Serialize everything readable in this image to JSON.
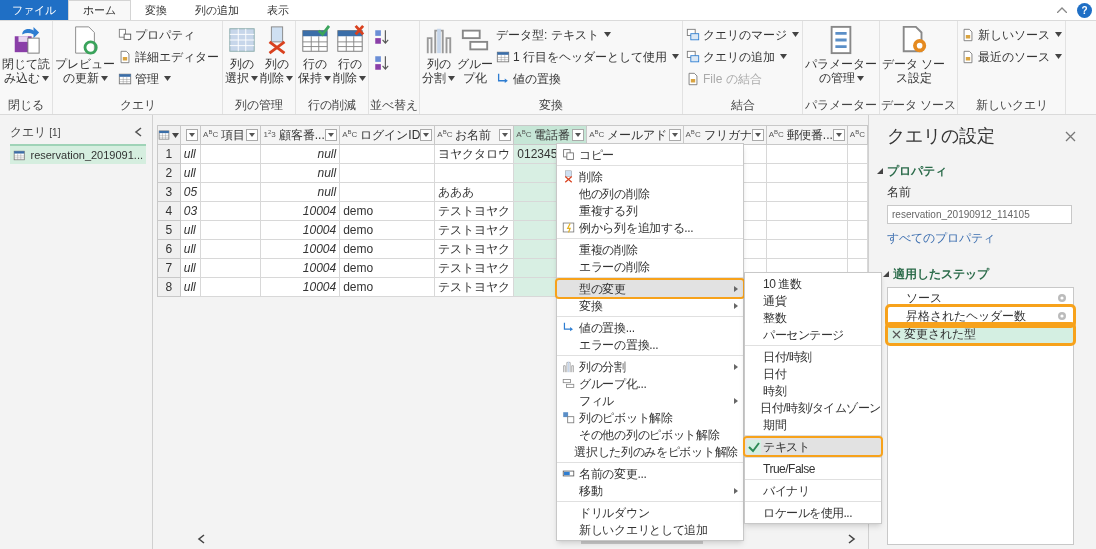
{
  "tabs": [
    {
      "label": "ファイル",
      "kind": "file",
      "selected": false
    },
    {
      "label": "ホーム",
      "kind": "tab",
      "selected": true
    },
    {
      "label": "変換",
      "kind": "tab",
      "selected": false
    },
    {
      "label": "列の追加",
      "kind": "tab",
      "selected": false
    },
    {
      "label": "表示",
      "kind": "tab",
      "selected": false
    }
  ],
  "help": "?",
  "ribbon": {
    "groups": [
      {
        "label": "閉じる",
        "columns": [
          {
            "kind": "large",
            "lines": [
              "閉じて読",
              "み込む"
            ],
            "menu": true
          }
        ]
      },
      {
        "label": "クエリ",
        "columns": [
          {
            "kind": "large",
            "lines": [
              "プレビュー",
              "の更新"
            ],
            "menu": true
          },
          {
            "kind": "stack",
            "items": [
              {
                "label": "プロパティ",
                "menu": false,
                "disabled": false
              },
              {
                "label": "詳細エディター",
                "menu": false,
                "disabled": false
              },
              {
                "label": "管理",
                "menu": true,
                "disabled": false
              }
            ]
          }
        ]
      },
      {
        "label": "列の管理",
        "columns": [
          {
            "kind": "large",
            "lines": [
              "列の",
              "選択"
            ],
            "menu": true
          },
          {
            "kind": "large",
            "lines": [
              "列の",
              "削除"
            ],
            "menu": true
          }
        ]
      },
      {
        "label": "行の削減",
        "columns": [
          {
            "kind": "large",
            "lines": [
              "行の",
              "保持"
            ],
            "menu": true
          },
          {
            "kind": "large",
            "lines": [
              "行の",
              "削除"
            ],
            "menu": true
          }
        ]
      },
      {
        "label": "並べ替え",
        "columns": [
          {
            "kind": "sort"
          }
        ]
      },
      {
        "label": "変換",
        "columns": [
          {
            "kind": "large",
            "lines": [
              "列の",
              "分割"
            ],
            "menu": true
          },
          {
            "kind": "large",
            "lines": [
              "グルー",
              "プ化"
            ],
            "menu": false
          },
          {
            "kind": "stack",
            "items": [
              {
                "label": "データ型: テキスト",
                "menu": true,
                "disabled": false
              },
              {
                "label": "1 行目をヘッダーとして使用",
                "menu": true,
                "disabled": false
              },
              {
                "label": "値の置換",
                "menu": false,
                "disabled": false
              }
            ]
          }
        ]
      },
      {
        "label": "結合",
        "columns": [
          {
            "kind": "stack",
            "items": [
              {
                "label": "クエリのマージ",
                "menu": true,
                "disabled": false
              },
              {
                "label": "クエリの追加",
                "menu": true,
                "disabled": false
              },
              {
                "label": "File の結合",
                "menu": false,
                "disabled": true
              }
            ]
          }
        ]
      },
      {
        "label": "パラメーター",
        "columns": [
          {
            "kind": "large",
            "lines": [
              "パラメーター",
              "の管理"
            ],
            "menu": true
          }
        ]
      },
      {
        "label": "データ ソース",
        "columns": [
          {
            "kind": "large",
            "lines": [
              "データ ソー",
              "ス設定"
            ],
            "menu": false
          }
        ]
      },
      {
        "label": "新しいクエリ",
        "columns": [
          {
            "kind": "stack",
            "items": [
              {
                "label": "新しいソース",
                "menu": true,
                "disabled": false
              },
              {
                "label": "最近のソース",
                "menu": true,
                "disabled": false
              }
            ]
          }
        ]
      }
    ]
  },
  "queries": {
    "title": "クエリ",
    "count": "[1]",
    "items": [
      {
        "label": "reservation_2019091...",
        "selected": true
      }
    ]
  },
  "table": {
    "columns": [
      {
        "kind": "date",
        "selected": false
      },
      {
        "type": "A$^{B}$C",
        "title": "項目",
        "kind": "text",
        "selected": false
      },
      {
        "type": "1$^{2}$3",
        "title": "顧客番...",
        "kind": "number",
        "selected": false
      },
      {
        "type": "A$^{B}$C",
        "title": "ログインID",
        "kind": "text",
        "selected": false
      },
      {
        "type": "A$^{B}$C",
        "title": "お名前",
        "kind": "text",
        "selected": false
      },
      {
        "type": "A$^{B}$C",
        "title": "電話番",
        "kind": "text",
        "selected": true
      },
      {
        "type": "A$^{B}$C",
        "title": "メールアド",
        "kind": "text",
        "selected": false
      },
      {
        "type": "A$^{B}$C",
        "title": "フリガナ",
        "kind": "text",
        "selected": false
      },
      {
        "type": "A$^{B}$C",
        "title": "郵便番...",
        "kind": "text",
        "selected": false
      },
      {
        "type": "A$^{B}$C",
        "kind": "text",
        "selected": false
      }
    ],
    "rows": [
      {
        "num": "1",
        "cells": [
          "ull",
          "",
          "null",
          "",
          "ヨヤクタロウ",
          "012345",
          "",
          "",
          "",
          ""
        ]
      },
      {
        "num": "2",
        "cells": [
          "ull",
          "",
          "null",
          "",
          "",
          "",
          "",
          "",
          "",
          ""
        ]
      },
      {
        "num": "3",
        "cells": [
          "05",
          "",
          "null",
          "",
          "あああ",
          "",
          "",
          "",
          "",
          ""
        ]
      },
      {
        "num": "4",
        "cells": [
          "03",
          "",
          "10004",
          "demo",
          "テストヨヤク",
          "",
          "",
          "",
          "",
          ""
        ]
      },
      {
        "num": "5",
        "cells": [
          "ull",
          "",
          "10004",
          "demo",
          "テストヨヤク",
          "",
          "",
          "",
          "",
          ""
        ]
      },
      {
        "num": "6",
        "cells": [
          "ull",
          "",
          "10004",
          "demo",
          "テストヨヤク",
          "",
          "",
          "",
          "",
          ""
        ]
      },
      {
        "num": "7",
        "cells": [
          "ull",
          "",
          "10004",
          "demo",
          "テストヨヤク",
          "",
          "",
          "",
          "",
          ""
        ]
      },
      {
        "num": "8",
        "cells": [
          "ull",
          "",
          "10004",
          "demo",
          "テストヨヤク",
          "",
          "",
          "",
          "",
          ""
        ]
      }
    ]
  },
  "context_menu": {
    "sections": [
      [
        {
          "label": "コピー",
          "submenu": false,
          "open": false,
          "annotated": false
        }
      ],
      [
        {
          "label": "削除",
          "submenu": false,
          "open": false,
          "annotated": false
        },
        {
          "label": "他の列の削除",
          "submenu": false,
          "open": false,
          "annotated": false
        },
        {
          "label": "重複する列",
          "submenu": false,
          "open": false,
          "annotated": false
        },
        {
          "label": "例から列を追加する...",
          "submenu": false,
          "open": false,
          "annotated": false
        }
      ],
      [
        {
          "label": "重複の削除",
          "submenu": false,
          "open": false,
          "annotated": false
        },
        {
          "label": "エラーの削除",
          "submenu": false,
          "open": false,
          "annotated": false
        }
      ],
      [
        {
          "label": "型の変更",
          "submenu": true,
          "open": true,
          "annotated": true
        },
        {
          "label": "変換",
          "submenu": true,
          "open": false,
          "annotated": false
        }
      ],
      [
        {
          "label": "値の置換...",
          "submenu": false,
          "open": false,
          "annotated": false
        },
        {
          "label": "エラーの置換...",
          "submenu": false,
          "open": false,
          "annotated": false
        }
      ],
      [
        {
          "label": "列の分割",
          "submenu": true,
          "open": false,
          "annotated": false
        },
        {
          "label": "グループ化...",
          "submenu": false,
          "open": false,
          "annotated": false
        },
        {
          "label": "フィル",
          "submenu": true,
          "open": false,
          "annotated": false
        },
        {
          "label": "列のピボット解除",
          "submenu": false,
          "open": false,
          "annotated": false
        },
        {
          "label": "その他の列のピボット解除",
          "submenu": false,
          "open": false,
          "annotated": false
        },
        {
          "label": "選択した列のみをピボット解除",
          "submenu": false,
          "open": false,
          "annotated": false
        }
      ],
      [
        {
          "label": "名前の変更...",
          "submenu": false,
          "open": false,
          "annotated": false
        },
        {
          "label": "移動",
          "submenu": true,
          "open": false,
          "annotated": false
        }
      ],
      [
        {
          "label": "ドリルダウン",
          "submenu": false,
          "open": false,
          "annotated": false
        },
        {
          "label": "新しいクエリとして追加",
          "submenu": false,
          "open": false,
          "annotated": false
        }
      ]
    ]
  },
  "type_menu": {
    "sections": [
      [
        {
          "label": "10 進数",
          "checked": false,
          "annotated": false
        },
        {
          "label": "通貨",
          "checked": false,
          "annotated": false
        },
        {
          "label": "整数",
          "checked": false,
          "annotated": false
        },
        {
          "label": "パーセンテージ",
          "checked": false,
          "annotated": false
        }
      ],
      [
        {
          "label": "日付/時刻",
          "checked": false,
          "annotated": false
        },
        {
          "label": "日付",
          "checked": false,
          "annotated": false
        },
        {
          "label": "時刻",
          "checked": false,
          "annotated": false
        },
        {
          "label": "日付/時刻/タイムゾーン",
          "checked": false,
          "annotated": false
        },
        {
          "label": "期間",
          "checked": false,
          "annotated": false
        }
      ],
      [
        {
          "label": "テキスト",
          "checked": true,
          "annotated": true
        }
      ],
      [
        {
          "label": "True/False",
          "checked": false,
          "annotated": false
        }
      ],
      [
        {
          "label": "バイナリ",
          "checked": false,
          "annotated": false
        }
      ],
      [
        {
          "label": "ロケールを使用...",
          "checked": false,
          "annotated": false
        }
      ]
    ]
  },
  "settings": {
    "title": "クエリの設定",
    "properties": {
      "heading": "プロパティ",
      "name_label": "名前",
      "name_value": "reservation_20190912_114105",
      "all_link": "すべてのプロパティ"
    },
    "steps": {
      "heading": "適用したステップ",
      "items": [
        {
          "label": "ソース",
          "settings": true,
          "selected": false,
          "annotated": false
        },
        {
          "label": "昇格されたヘッダー数",
          "settings": true,
          "selected": false,
          "annotated": true
        },
        {
          "label": "変更された型",
          "settings": false,
          "selected": true,
          "annotated": true
        }
      ]
    }
  }
}
